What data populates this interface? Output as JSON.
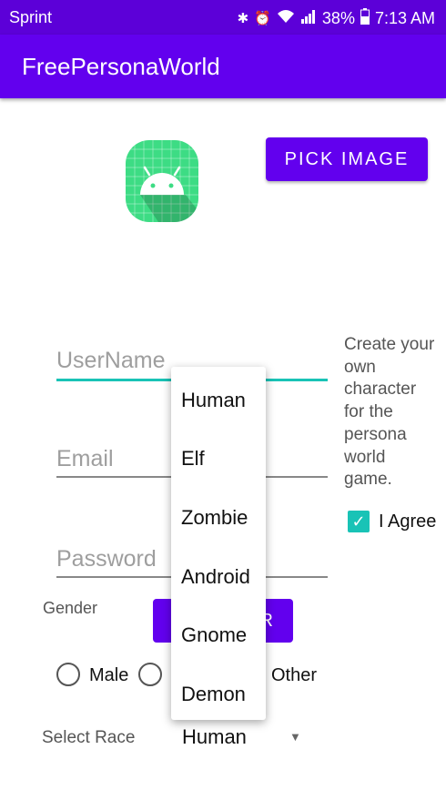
{
  "status_bar": {
    "carrier": "Sprint",
    "battery": "38%",
    "time": "7:13 AM",
    "icons": [
      "bluetooth-icon",
      "alarm-icon",
      "wifi-icon",
      "signal-icon",
      "battery-icon"
    ]
  },
  "app_bar": {
    "title": "FreePersonaWorld"
  },
  "colors": {
    "primary": "#6200ee",
    "status_bar": "#5c00d8",
    "accent": "#19c3b6",
    "logo_green": "#3ddc84"
  },
  "pick_image": {
    "label": "PICK IMAGE"
  },
  "form": {
    "username": {
      "placeholder": "UserName"
    },
    "email": {
      "placeholder": "Email"
    },
    "password": {
      "placeholder": "Password"
    }
  },
  "info": {
    "text": "Create your own character for the persona world game."
  },
  "agree": {
    "label": "I Agree",
    "checked": true
  },
  "gender": {
    "label": "Gender",
    "options": [
      "Male",
      "Other"
    ]
  },
  "register": {
    "label": "R"
  },
  "race": {
    "label": "Select Race",
    "selected": "Human",
    "options": [
      "Human",
      "Elf",
      "Zombie",
      "Android",
      "Gnome",
      "Demon"
    ]
  }
}
